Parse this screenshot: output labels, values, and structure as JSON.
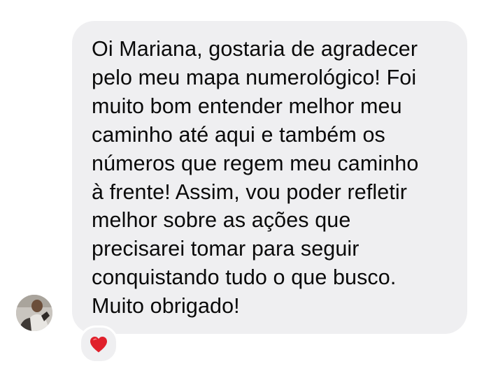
{
  "message": {
    "lines": [
      "Oi Mariana, gostaria de agradecer",
      "pelo meu mapa numerológico! Foi",
      "muito bom entender melhor meu",
      "caminho até aqui e também os",
      "números que regem meu caminho",
      "à frente! Assim, vou poder refletir",
      "melhor sobre as ações que",
      "precisarei tomar para seguir",
      "conquistando tudo o que busco.",
      "Muito obrigado!"
    ]
  },
  "reaction": {
    "icon": "heart-icon",
    "color": "#e0202b"
  },
  "colors": {
    "bubble_background": "#efeff1",
    "text": "#0a0a0a",
    "page_background": "#ffffff"
  }
}
